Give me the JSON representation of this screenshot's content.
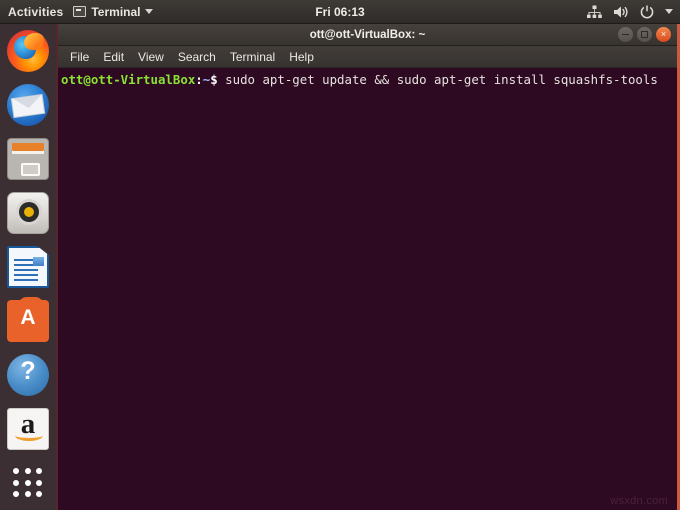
{
  "topbar": {
    "activities": "Activities",
    "app_name": "Terminal",
    "app_icon": "terminal-icon",
    "clock": "Fri 06:13",
    "tray": [
      {
        "name": "network-icon",
        "label": "Network"
      },
      {
        "name": "volume-icon",
        "label": "Volume"
      },
      {
        "name": "power-icon",
        "label": "Power"
      },
      {
        "name": "chevron-down-icon",
        "label": "System menu"
      }
    ]
  },
  "launcher": {
    "items": [
      {
        "name": "firefox",
        "label": "Firefox Web Browser",
        "class": "ff"
      },
      {
        "name": "thunderbird",
        "label": "Thunderbird Mail",
        "class": "tb"
      },
      {
        "name": "files",
        "label": "Files",
        "class": "files"
      },
      {
        "name": "rhythmbox",
        "label": "Rhythmbox",
        "class": "rb"
      },
      {
        "name": "libreoffice-writer",
        "label": "LibreOffice Writer",
        "class": "lo"
      },
      {
        "name": "ubuntu-software",
        "label": "Ubuntu Software",
        "class": "us"
      },
      {
        "name": "help",
        "label": "Help",
        "class": "help"
      },
      {
        "name": "amazon",
        "label": "Amazon",
        "class": "amz"
      }
    ],
    "show_apps_label": "Show Applications"
  },
  "window": {
    "title": "ott@ott-VirtualBox: ~",
    "controls": {
      "minimize": "Minimize",
      "maximize": "Maximize",
      "close": "Close",
      "close_glyph": "×"
    },
    "menu": [
      "File",
      "Edit",
      "View",
      "Search",
      "Terminal",
      "Help"
    ]
  },
  "terminal": {
    "prompt": {
      "user_host": "ott@ott-VirtualBox",
      "colon": ":",
      "path": "~",
      "dollar": "$"
    },
    "command": " sudo apt-get update && sudo apt-get install squashfs-tools",
    "full_line": "ott@ott-VirtualBox:~$ sudo apt-get update && sudo apt-get install squashfs-tools"
  },
  "watermark": "wsxdn.com",
  "colors": {
    "terminal_bg": "#2D0922",
    "prompt_green": "#8ae234",
    "window_border_accent": "#cd5a3c",
    "close_button": "#dc4a1e",
    "launcher_bg": "#3b2f33",
    "topbar_bg": "#3e3b37"
  }
}
